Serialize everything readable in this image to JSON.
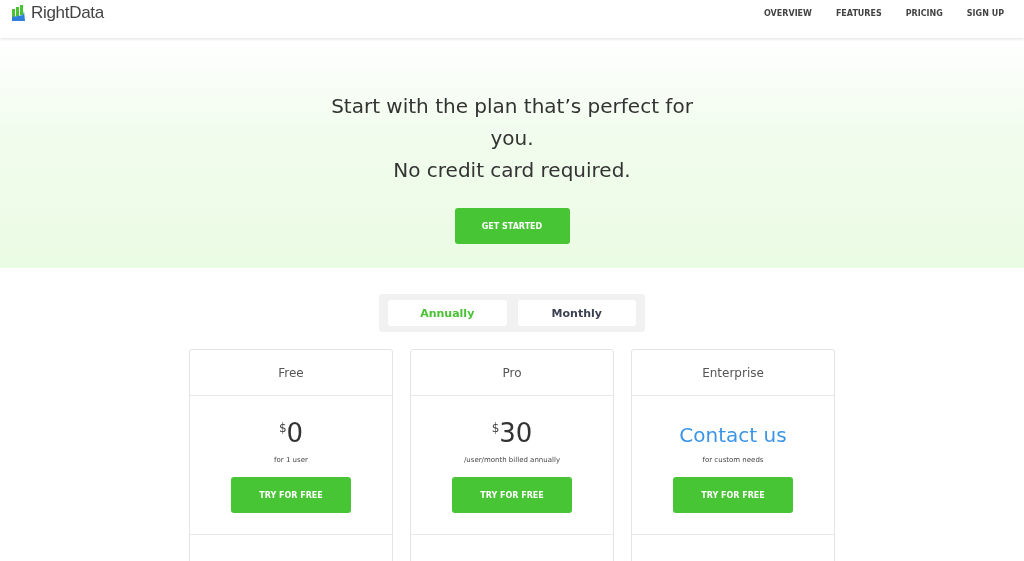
{
  "brand": {
    "name": "RightData"
  },
  "nav": [
    {
      "label": "OVERVIEW"
    },
    {
      "label": "FEATURES"
    },
    {
      "label": "PRICING"
    },
    {
      "label": "SIGN UP"
    }
  ],
  "hero": {
    "lines": [
      "Start with the plan that’s perfect for you.",
      "No credit card required."
    ],
    "button": "GET STARTED"
  },
  "billing_tabs": [
    {
      "label": "Annually",
      "selected": true
    },
    {
      "label": "Monthly",
      "selected": false
    }
  ],
  "plans": [
    {
      "name": "Free",
      "kind": "price",
      "currency": "$",
      "amount": "0",
      "note": "for 1 user",
      "button": "TRY FOR FREE"
    },
    {
      "name": "Pro",
      "kind": "price",
      "currency": "$",
      "amount": "30",
      "note": "/user/month billed annually",
      "button": "TRY FOR FREE"
    },
    {
      "name": "Enterprise",
      "kind": "contact",
      "contact": "Contact us",
      "note": "for custom needs",
      "button": "TRY FOR FREE"
    }
  ]
}
